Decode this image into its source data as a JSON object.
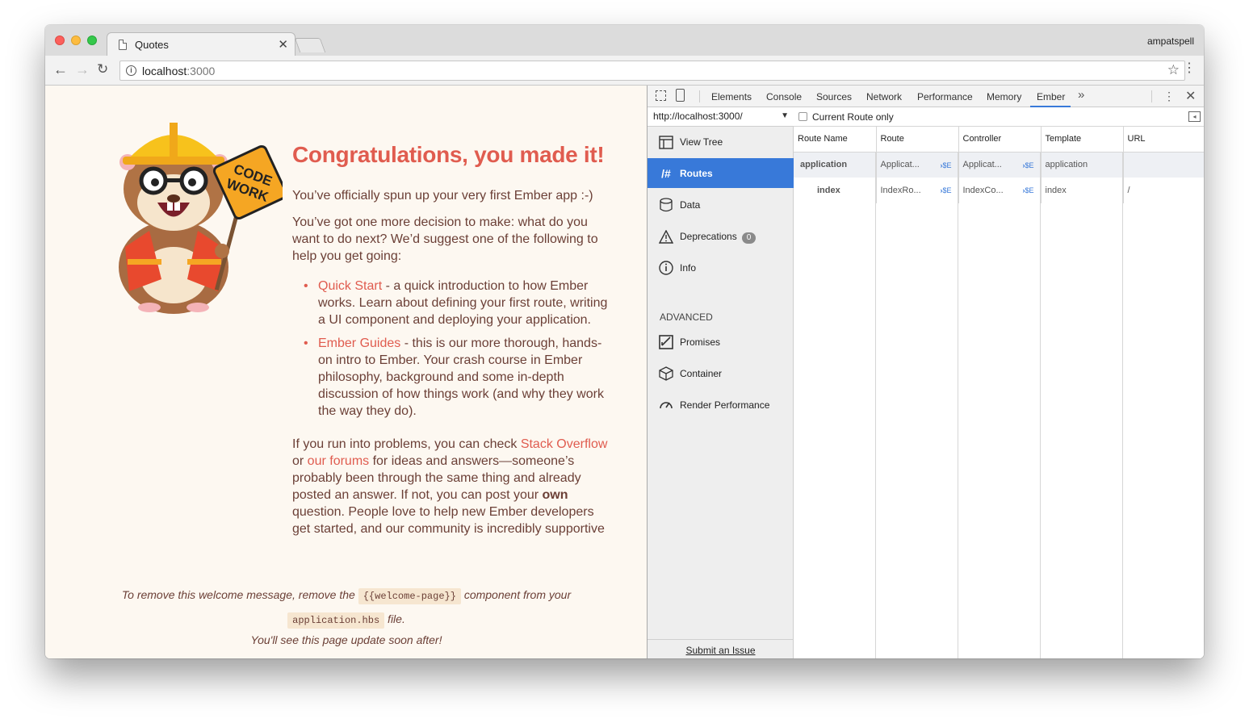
{
  "window": {
    "tab_title": "Quotes",
    "profile": "ampatspell",
    "url_host": "localhost",
    "url_port": ":3000"
  },
  "page": {
    "heading": "Congratulations, you made it!",
    "intro": "You’ve officially spun up your very first Ember app :-)",
    "decision": "You’ve got one more decision to make: what do you want to do next? We’d suggest one of the following to help you get going:",
    "list": [
      {
        "link": "Quick Start",
        "text": " - a quick introduction to how Ember works. Learn about defining your first route, writing a UI component and deploying your application."
      },
      {
        "link": "Ember Guides",
        "text": " - this is our more thorough, hands-on intro to Ember. Your crash course in Ember philosophy, background and some in-depth discussion of how things work (and why they work the way they do)."
      }
    ],
    "help": {
      "t1": "If you run into problems, you can check ",
      "link1": "Stack Overflow",
      "t2": " or ",
      "link2": "our forums",
      "t3": " for ideas and answers—someone’s probably been through the same thing and already posted an answer. If not, you can post your ",
      "bold": "own",
      "t4": " question. People love to help new Ember developers get started, and our community is incredibly supportive"
    },
    "note": {
      "t1": "To remove this welcome message, remove the ",
      "code1": "{{welcome-page}}",
      "t2": " component from your",
      "code2": "application.hbs",
      "t3": " file.",
      "t4": "You'll see this page update soon after!"
    },
    "mascot_sign": [
      "CODE",
      "WORK"
    ]
  },
  "devtools": {
    "tabs": [
      "Elements",
      "Console",
      "Sources",
      "Network",
      "Performance",
      "Memory",
      "Ember"
    ],
    "active_tab": "Ember",
    "app_url": "http://localhost:3000/",
    "filter_label": "Current Route only",
    "nav": [
      {
        "label": "View Tree",
        "icon": "view-tree-icon"
      },
      {
        "label": "Routes",
        "icon": "routes-icon",
        "glyph": "/#"
      },
      {
        "label": "Data",
        "icon": "data-icon"
      },
      {
        "label": "Deprecations",
        "icon": "warning-icon",
        "badge": "0"
      },
      {
        "label": "Info",
        "icon": "info-icon"
      }
    ],
    "advanced_label": "ADVANCED",
    "advanced_nav": [
      {
        "label": "Promises",
        "icon": "promises-icon"
      },
      {
        "label": "Container",
        "icon": "container-icon"
      },
      {
        "label": "Render Performance",
        "icon": "gauge-icon"
      }
    ],
    "submit_issue": "Submit an Issue",
    "columns": [
      "Route Name",
      "Route",
      "Controller",
      "Template",
      "URL"
    ],
    "rows": [
      {
        "name": "application",
        "route": "Applicat...",
        "controller": "Applicat...",
        "template": "application",
        "url": ""
      },
      {
        "name": "index",
        "route": "IndexRo...",
        "controller": "IndexCo...",
        "template": "index",
        "url": "/"
      }
    ],
    "se_label": "$E"
  },
  "colors": {
    "accent": "#3879d9",
    "ember_red": "#e05c4f",
    "page_bg": "#fdf8f1"
  }
}
